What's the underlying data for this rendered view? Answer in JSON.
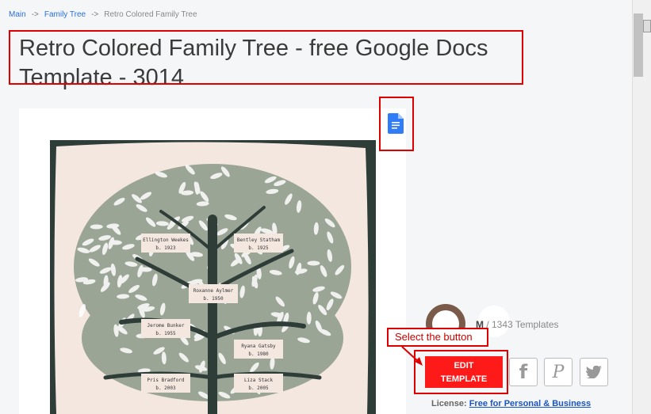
{
  "breadcrumb": {
    "items": [
      "Main",
      "Family Tree",
      "Retro Colored Family Tree"
    ],
    "separator": "->"
  },
  "page_title": "Retro Colored Family Tree - free Google Docs Template - 3014",
  "tree_names": [
    {
      "name": "Ellington Weekes",
      "born": "b. 1923"
    },
    {
      "name": "Bentley Statham",
      "born": "b. 1925"
    },
    {
      "name": "Roxanne Aylmer",
      "born": "b. 1950"
    },
    {
      "name": "Jerome Bunker",
      "born": "b. 1955"
    },
    {
      "name": "Ryana Gatsby",
      "born": "b. 1980"
    },
    {
      "name": "Pris Bradford",
      "born": "b. 2003"
    },
    {
      "name": "Liza Stack",
      "born": "b. 2005"
    }
  ],
  "author": {
    "name_partial": "M",
    "templates": "/ 1343 Templates"
  },
  "callout": "Select the button",
  "edit_button": {
    "line1": "EDIT",
    "line2": "TEMPLATE"
  },
  "license": {
    "label": "License:",
    "value": "Free for Personal & Business"
  },
  "icons": {
    "docs": "google-docs-icon",
    "facebook": "facebook-icon",
    "pinterest": "pinterest-icon",
    "twitter": "twitter-icon"
  },
  "colors": {
    "accent_red": "#ff1a1a",
    "annotation_red": "#e00000",
    "link_blue": "#2a6fdb",
    "poster_bg": "#2f3d39",
    "poster_paper": "#f4e7e0",
    "tree_green": "#9aa596"
  }
}
